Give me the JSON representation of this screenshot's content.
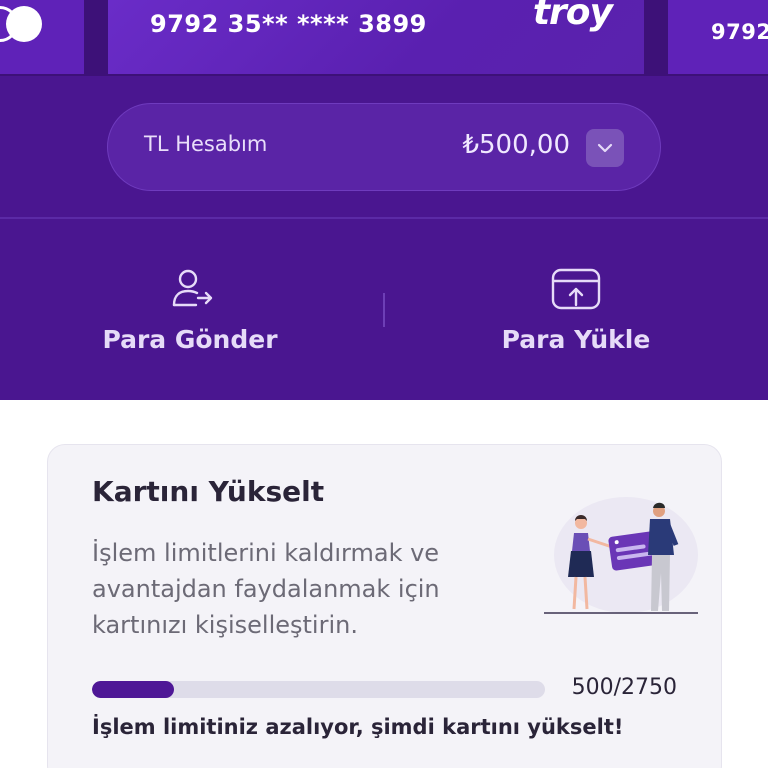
{
  "cards": {
    "main": {
      "number": "9792 35** **** 3899",
      "brand": "troy"
    },
    "next": {
      "number": "9792"
    }
  },
  "account": {
    "label": "TL Hesabım",
    "balance": "₺500,00"
  },
  "actions": {
    "send_label": "Para Gönder",
    "load_label": "Para Yükle"
  },
  "upgrade": {
    "title": "Kartını Yükselt",
    "description": "İşlem limitlerini kaldırmak ve avantajdan faydalanmak için kartınızı kişiselleştirin.",
    "progress_text": "500/2750",
    "progress_value": 500,
    "progress_max": 2750,
    "warning": "İşlem limitiniz azalıyor, şimdi kartını yükselt!"
  },
  "colors": {
    "header_bg": "#4a1690",
    "accent": "#4e1796",
    "card_bg": "#f4f3f8"
  },
  "icons": {
    "send": "user-arrow-icon",
    "load": "card-upload-icon",
    "dropdown": "chevron-down-icon"
  }
}
